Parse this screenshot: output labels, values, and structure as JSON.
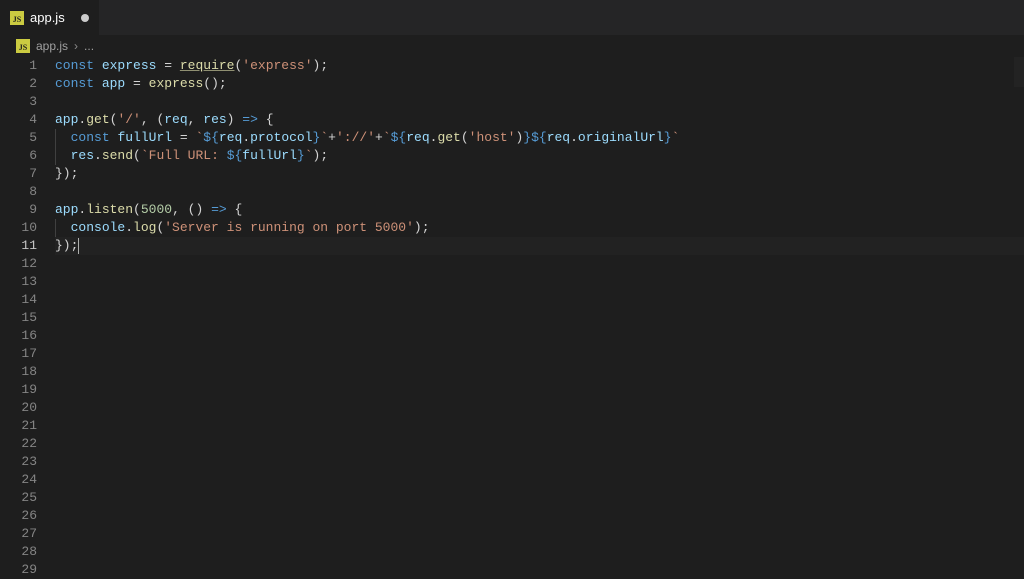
{
  "tab": {
    "icon": "js",
    "label": "app.js",
    "dirty": true
  },
  "breadcrumbs": {
    "icon": "js",
    "file": "app.js",
    "separator": "›",
    "tail": "..."
  },
  "editor": {
    "active_line": 11,
    "total_lines": 29,
    "code": [
      {
        "n": 1,
        "indent": 0,
        "tokens": [
          [
            "kw",
            "const"
          ],
          [
            "pn",
            " "
          ],
          [
            "var",
            "express"
          ],
          [
            "pn",
            " "
          ],
          [
            "op",
            "="
          ],
          [
            "pn",
            " "
          ],
          [
            "reqfn",
            "require"
          ],
          [
            "pn",
            "("
          ],
          [
            "str",
            "'express'"
          ],
          [
            "pn",
            ");"
          ]
        ]
      },
      {
        "n": 2,
        "indent": 0,
        "tokens": [
          [
            "kw",
            "const"
          ],
          [
            "pn",
            " "
          ],
          [
            "var",
            "app"
          ],
          [
            "pn",
            " "
          ],
          [
            "op",
            "="
          ],
          [
            "pn",
            " "
          ],
          [
            "fn",
            "express"
          ],
          [
            "pn",
            "();"
          ]
        ]
      },
      {
        "n": 3,
        "indent": 0,
        "tokens": []
      },
      {
        "n": 4,
        "indent": 0,
        "tokens": [
          [
            "var",
            "app"
          ],
          [
            "pn",
            "."
          ],
          [
            "fnprop",
            "get"
          ],
          [
            "pn",
            "("
          ],
          [
            "str",
            "'/'"
          ],
          [
            "pn",
            ", ("
          ],
          [
            "var",
            "req"
          ],
          [
            "pn",
            ", "
          ],
          [
            "var",
            "res"
          ],
          [
            "pn",
            ") "
          ],
          [
            "kw",
            "=>"
          ],
          [
            "pn",
            " {"
          ]
        ]
      },
      {
        "n": 5,
        "indent": 1,
        "tokens": [
          [
            "kw",
            "const"
          ],
          [
            "pn",
            " "
          ],
          [
            "var",
            "fullUrl"
          ],
          [
            "pn",
            " "
          ],
          [
            "op",
            "="
          ],
          [
            "pn",
            " "
          ],
          [
            "tmpl",
            "`"
          ],
          [
            "tpunc",
            "${"
          ],
          [
            "var",
            "req"
          ],
          [
            "pn",
            "."
          ],
          [
            "prop",
            "protocol"
          ],
          [
            "tpunc",
            "}"
          ],
          [
            "tmpl",
            "`"
          ],
          [
            "op",
            "+"
          ],
          [
            "str",
            "'://'"
          ],
          [
            "op",
            "+"
          ],
          [
            "tmpl",
            "`"
          ],
          [
            "tpunc",
            "${"
          ],
          [
            "var",
            "req"
          ],
          [
            "pn",
            "."
          ],
          [
            "fnprop",
            "get"
          ],
          [
            "pn",
            "("
          ],
          [
            "str",
            "'host'"
          ],
          [
            "pn",
            ")"
          ],
          [
            "tpunc",
            "}${"
          ],
          [
            "var",
            "req"
          ],
          [
            "pn",
            "."
          ],
          [
            "prop",
            "originalUrl"
          ],
          [
            "tpunc",
            "}"
          ],
          [
            "tmpl",
            "`"
          ]
        ]
      },
      {
        "n": 6,
        "indent": 1,
        "tokens": [
          [
            "var",
            "res"
          ],
          [
            "pn",
            "."
          ],
          [
            "fnprop",
            "send"
          ],
          [
            "pn",
            "("
          ],
          [
            "tmpl",
            "`Full URL: "
          ],
          [
            "tpunc",
            "${"
          ],
          [
            "var",
            "fullUrl"
          ],
          [
            "tpunc",
            "}"
          ],
          [
            "tmpl",
            "`"
          ],
          [
            "pn",
            ");"
          ]
        ]
      },
      {
        "n": 7,
        "indent": 0,
        "tokens": [
          [
            "pn",
            "});"
          ]
        ]
      },
      {
        "n": 8,
        "indent": 0,
        "tokens": []
      },
      {
        "n": 9,
        "indent": 0,
        "tokens": [
          [
            "var",
            "app"
          ],
          [
            "pn",
            "."
          ],
          [
            "fnprop",
            "listen"
          ],
          [
            "pn",
            "("
          ],
          [
            "num",
            "5000"
          ],
          [
            "pn",
            ", () "
          ],
          [
            "kw",
            "=>"
          ],
          [
            "pn",
            " {"
          ]
        ]
      },
      {
        "n": 10,
        "indent": 1,
        "tokens": [
          [
            "var",
            "console"
          ],
          [
            "pn",
            "."
          ],
          [
            "fnprop",
            "log"
          ],
          [
            "pn",
            "("
          ],
          [
            "str",
            "'Server is running on port 5000'"
          ],
          [
            "pn",
            ");"
          ]
        ]
      },
      {
        "n": 11,
        "indent": 0,
        "tokens": [
          [
            "pn",
            "});"
          ]
        ],
        "cursor_after": true
      },
      {
        "n": 12,
        "indent": 0,
        "tokens": []
      }
    ]
  }
}
